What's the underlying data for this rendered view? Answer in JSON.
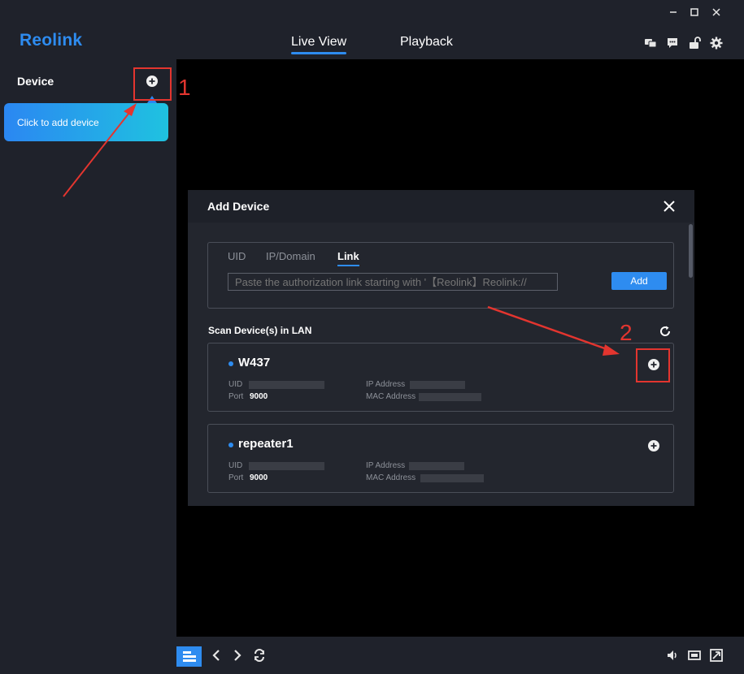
{
  "app": {
    "logo": "Reolink",
    "tabs": [
      {
        "label": "Live View",
        "active": true
      },
      {
        "label": "Playback",
        "active": false
      }
    ],
    "window_controls": [
      "minimize-icon",
      "maximize-icon",
      "close-icon"
    ],
    "header_icons": [
      "chat-icon",
      "message-icon",
      "unlock-icon",
      "gear-icon"
    ]
  },
  "sidebar": {
    "title": "Device",
    "add_device_hint": "Click to add device"
  },
  "dialog": {
    "title": "Add Device",
    "tabs": [
      {
        "label": "UID",
        "active": false
      },
      {
        "label": "IP/Domain",
        "active": false
      },
      {
        "label": "Link",
        "active": true
      }
    ],
    "link_placeholder": "Paste the authorization link starting with '【Reolink】Reolink://",
    "add_button": "Add",
    "scan_title": "Scan Device(s) in LAN",
    "devices": [
      {
        "name": "W437",
        "uid_label": "UID",
        "port_label": "Port",
        "port": "9000",
        "ip_label": "IP Address",
        "mac_label": "MAC Address"
      },
      {
        "name": "repeater1",
        "uid_label": "UID",
        "port_label": "Port",
        "port": "9000",
        "ip_label": "IP Address",
        "mac_label": "MAC Address"
      }
    ]
  },
  "annotations": {
    "step1": "1",
    "step2": "2"
  },
  "bottom_icons": [
    "layout-icon",
    "prev-icon",
    "next-icon",
    "rotate-icon",
    "volume-icon",
    "screen-icon",
    "fullscreen-icon"
  ],
  "colors": {
    "accent": "#2e8cf0",
    "panel": "#1f222b",
    "annotation": "#e3352f"
  }
}
